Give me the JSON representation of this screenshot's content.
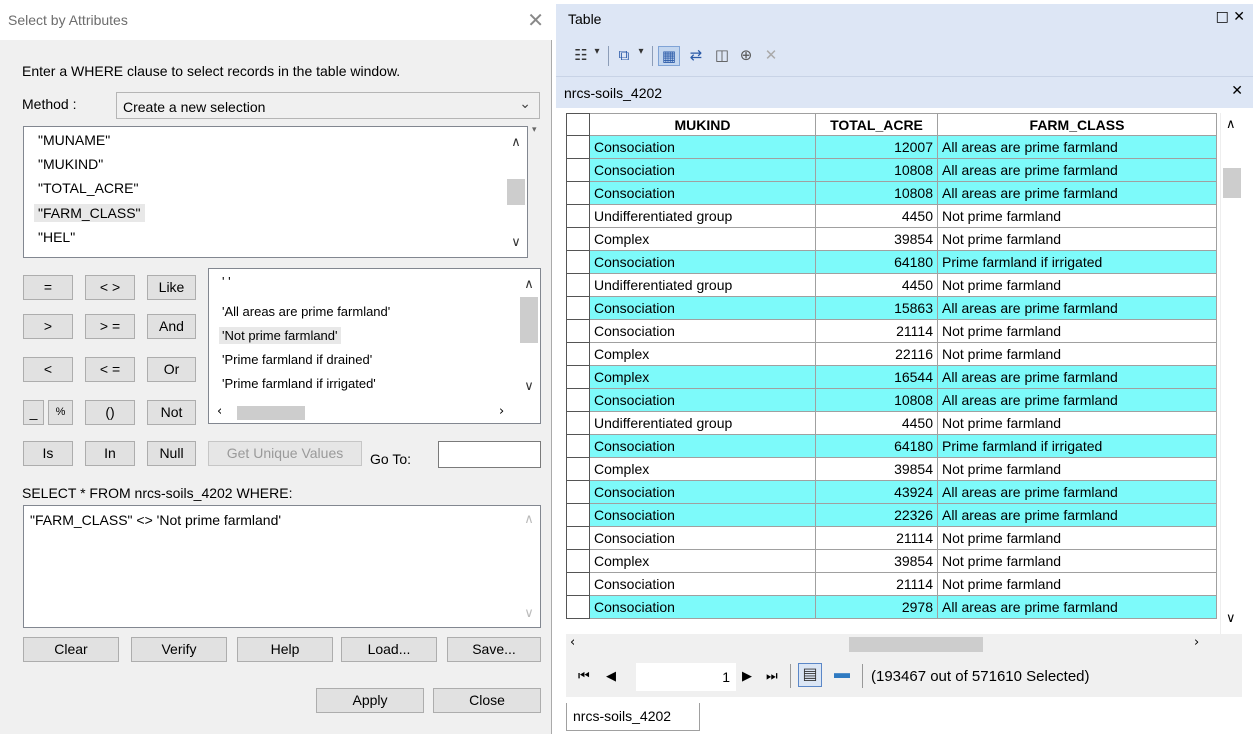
{
  "dialog": {
    "title": "Select by Attributes",
    "close_glyph": "✕",
    "instruction": "Enter a WHERE clause to select records in the table window.",
    "method_label": "Method :",
    "method_value": "Create a new selection",
    "fields": [
      "\"MUNAME\"",
      "\"MUKIND\"",
      "\"TOTAL_ACRE\"",
      "\"FARM_CLASS\"",
      "\"HEL\""
    ],
    "operators": {
      "eq": "=",
      "ne": "< >",
      "like": "Like",
      "gt": ">",
      "ge": "> =",
      "and": "And",
      "lt": "<",
      "le": "< =",
      "or": "Or",
      "underscore": "_",
      "percent": "%",
      "parens": "()",
      "not": "Not",
      "is": "Is",
      "in": "In",
      "null": "Null"
    },
    "values": [
      "' '",
      "'All areas are prime farmland'",
      "'Not prime farmland'",
      "'Prime farmland if drained'",
      "'Prime farmland if irrigated'"
    ],
    "get_unique_label": "Get Unique Values",
    "goto_label": "Go To:",
    "goto_value": "",
    "select_label": "SELECT * FROM nrcs-soils_4202 WHERE:",
    "where_clause": "\"FARM_CLASS\" <> 'Not prime farmland'",
    "buttons": {
      "clear": "Clear",
      "verify": "Verify",
      "help": "Help",
      "load": "Load...",
      "save": "Save...",
      "apply": "Apply",
      "close": "Close"
    }
  },
  "table_window": {
    "title": "Table",
    "window_controls": "□ ✕",
    "table_name": "nrcs-soils_4202",
    "close_glyph": "✕",
    "columns": [
      "MUKIND",
      "TOTAL_ACRE",
      "FARM_CLASS"
    ],
    "rows": [
      {
        "mukind": "Consociation",
        "total_acre": "12007",
        "farm_class": "All areas are prime farmland",
        "selected": true
      },
      {
        "mukind": "Consociation",
        "total_acre": "10808",
        "farm_class": "All areas are prime farmland",
        "selected": true
      },
      {
        "mukind": "Consociation",
        "total_acre": "10808",
        "farm_class": "All areas are prime farmland",
        "selected": true
      },
      {
        "mukind": "Undifferentiated group",
        "total_acre": "4450",
        "farm_class": "Not prime farmland",
        "selected": false
      },
      {
        "mukind": "Complex",
        "total_acre": "39854",
        "farm_class": "Not prime farmland",
        "selected": false
      },
      {
        "mukind": "Consociation",
        "total_acre": "64180",
        "farm_class": "Prime farmland if irrigated",
        "selected": true
      },
      {
        "mukind": "Undifferentiated group",
        "total_acre": "4450",
        "farm_class": "Not prime farmland",
        "selected": false
      },
      {
        "mukind": "Consociation",
        "total_acre": "15863",
        "farm_class": "All areas are prime farmland",
        "selected": true
      },
      {
        "mukind": "Consociation",
        "total_acre": "21114",
        "farm_class": "Not prime farmland",
        "selected": false
      },
      {
        "mukind": "Complex",
        "total_acre": "22116",
        "farm_class": "Not prime farmland",
        "selected": false
      },
      {
        "mukind": "Complex",
        "total_acre": "16544",
        "farm_class": "All areas are prime farmland",
        "selected": true
      },
      {
        "mukind": "Consociation",
        "total_acre": "10808",
        "farm_class": "All areas are prime farmland",
        "selected": true
      },
      {
        "mukind": "Undifferentiated group",
        "total_acre": "4450",
        "farm_class": "Not prime farmland",
        "selected": false
      },
      {
        "mukind": "Consociation",
        "total_acre": "64180",
        "farm_class": "Prime farmland if irrigated",
        "selected": true
      },
      {
        "mukind": "Complex",
        "total_acre": "39854",
        "farm_class": "Not prime farmland",
        "selected": false
      },
      {
        "mukind": "Consociation",
        "total_acre": "43924",
        "farm_class": "All areas are prime farmland",
        "selected": true
      },
      {
        "mukind": "Consociation",
        "total_acre": "22326",
        "farm_class": "All areas are prime farmland",
        "selected": true
      },
      {
        "mukind": "Consociation",
        "total_acre": "21114",
        "farm_class": "Not prime farmland",
        "selected": false
      },
      {
        "mukind": "Complex",
        "total_acre": "39854",
        "farm_class": "Not prime farmland",
        "selected": false
      },
      {
        "mukind": "Consociation",
        "total_acre": "21114",
        "farm_class": "Not prime farmland",
        "selected": false
      },
      {
        "mukind": "Consociation",
        "total_acre": "2978",
        "farm_class": "All areas are prime farmland",
        "selected": true
      }
    ],
    "record_number": "1",
    "selection_status": "(193467 out of 571610 Selected)",
    "bottom_tab": "nrcs-soils_4202",
    "selected_color": "#7dfafa"
  }
}
